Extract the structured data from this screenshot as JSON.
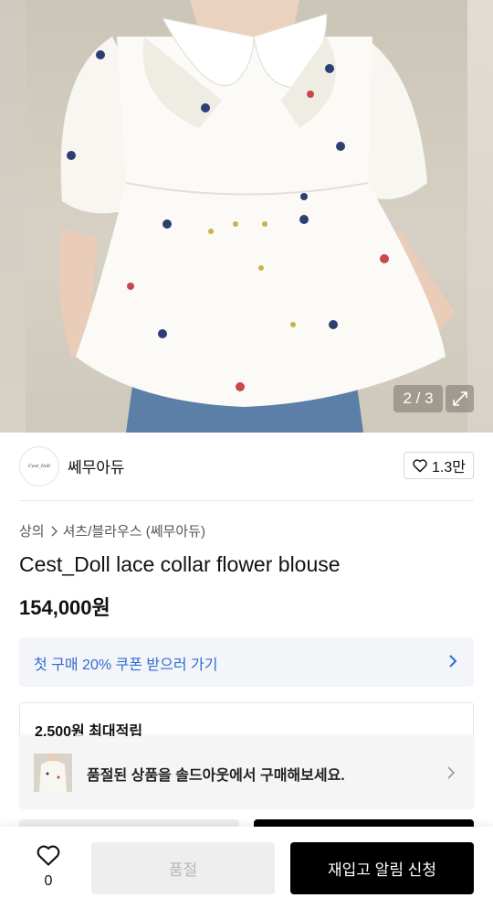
{
  "gallery": {
    "counter": "2 / 3",
    "image_alt": "product photo: white blouse with lace collar and flower embroidery"
  },
  "brand": {
    "logo_text": "Cest_Doll",
    "name": "쎄무아듀",
    "likes": "1.3만"
  },
  "breadcrumb": {
    "category": "상의",
    "subcategory": "셔츠/블라우스 (쎄무아듀)"
  },
  "product": {
    "title": "Cest_Doll lace collar flower blouse",
    "price": "154,000원"
  },
  "coupon": {
    "label": "첫 구매 20% 쿠폰 받으러 가기"
  },
  "points": {
    "label": "2,500원 최대적립"
  },
  "soldout_banner": {
    "text": "품절된 상품을 솔드아웃에서 구매해보세요."
  },
  "bottom_bar": {
    "wish_count": "0",
    "soldout_label": "품절",
    "restock_label": "재입고 알림 신청"
  },
  "colors": {
    "coupon_text": "#2f6bd6",
    "coupon_bg": "#f3f5f8",
    "primary_button": "#000000",
    "disabled_button": "#eeeeee"
  }
}
